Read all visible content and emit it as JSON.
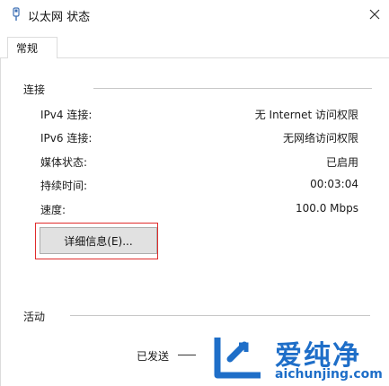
{
  "window": {
    "title": "以太网 状态",
    "icon": "network-adapter-icon",
    "close_icon": "close-icon"
  },
  "tabs": [
    {
      "label": "常规",
      "selected": true
    }
  ],
  "connection": {
    "group_title": "连接",
    "rows": [
      {
        "label": "IPv4 连接:",
        "value": "无 Internet 访问权限"
      },
      {
        "label": "IPv6 连接:",
        "value": "无网络访问权限"
      },
      {
        "label": "媒体状态:",
        "value": "已启用"
      },
      {
        "label": "持续时间:",
        "value": "00:03:04"
      },
      {
        "label": "速度:",
        "value": "100.0 Mbps"
      }
    ],
    "details_button": "详细信息(E)..."
  },
  "activity": {
    "group_title": "活动",
    "sent_label": "已发送"
  },
  "watermark": {
    "brand": "爱纯净",
    "url": "aichunjing.com",
    "color": "#1e6ec8"
  },
  "colors": {
    "highlight_border": "#e02b2b",
    "button_bg": "#e1e1e1"
  }
}
